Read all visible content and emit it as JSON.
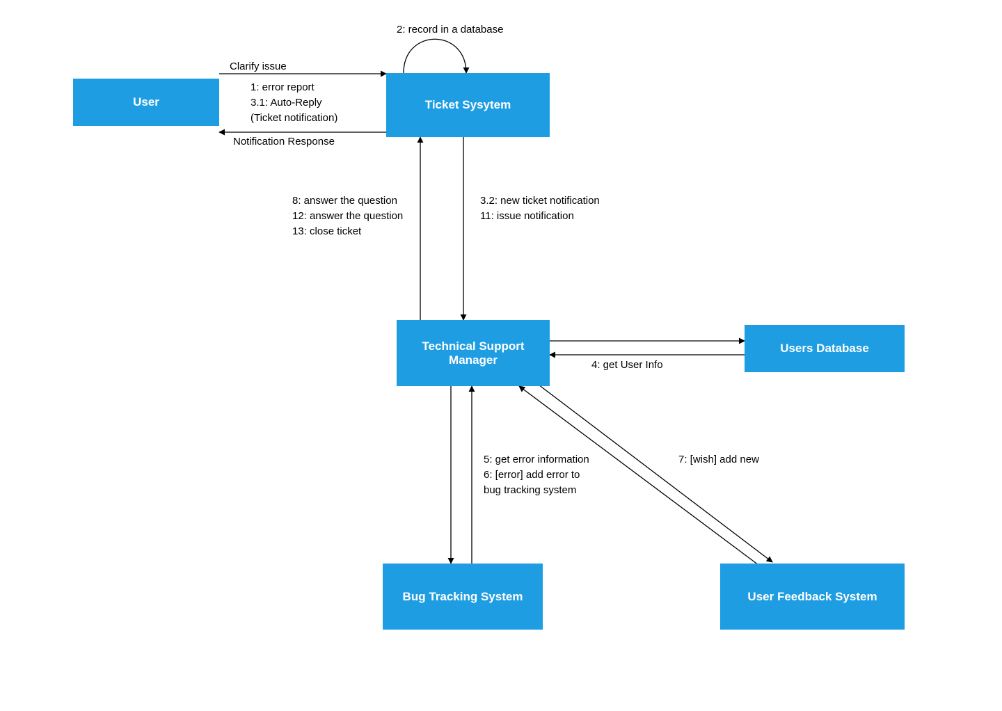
{
  "nodes": {
    "user": "User",
    "ticket_system": "Ticket Sysytem",
    "tsm": "Technical Support\nManager",
    "users_db": "Users Database",
    "bug_tracking": "Bug Tracking System",
    "feedback": "User Feedback System"
  },
  "labels": {
    "self_loop": "2: record in a database",
    "clarify": "Clarify issue",
    "error_report_block": "1: error report\n3.1: Auto-Reply\n(Ticket notification)",
    "notification_response": "Notification Response",
    "up_to_ts": "8: answer the question\n12: answer the question\n13: close ticket",
    "down_to_tsm": "3.2: new ticket notification\n11: issue notification",
    "get_user_info": "4: get User Info",
    "to_bug": "5: get error information\n6: [error] add error to\nbug tracking system",
    "wish_add_new": "7: [wish] add new"
  }
}
